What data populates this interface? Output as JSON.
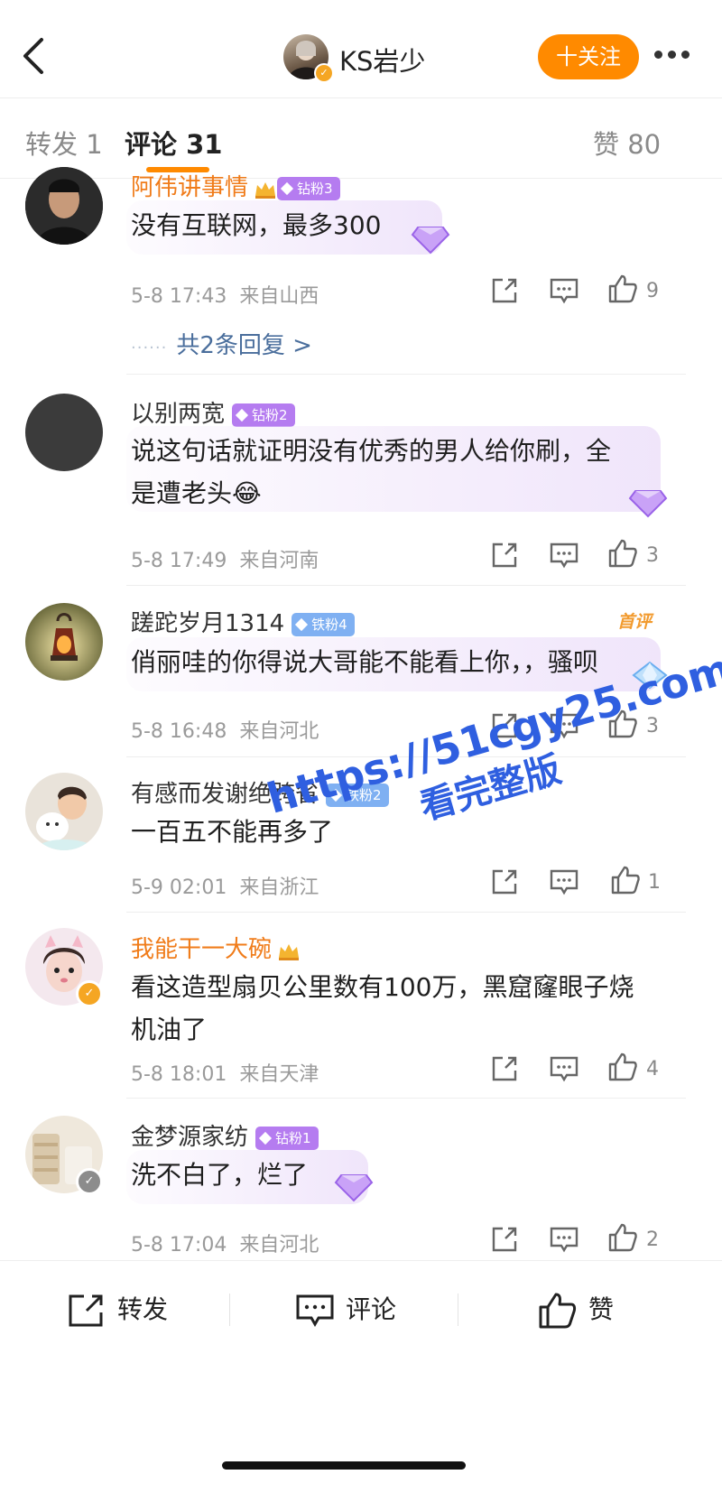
{
  "header": {
    "author_name": "KS岩少",
    "follow_label": "十关注"
  },
  "tabs": {
    "reposts": "转发 1",
    "comments": "评论 31",
    "likes": "赞 80"
  },
  "comments": [
    {
      "username": "阿伟讲事情",
      "name_color": "#f07c1a",
      "badge": "钻粉3",
      "text_lines": [
        "没有互联网，最多300"
      ],
      "date": "5-8 17:43",
      "location": "来自山西",
      "likes": "9",
      "replies": "共2条回复 >"
    },
    {
      "username": "以别两宽",
      "badge": "钻粉2",
      "text_lines": [
        "说这句话就证明没有优秀的男人给你刷，全",
        "是遭老头😂"
      ],
      "date": "5-8 17:49",
      "location": "来自河南",
      "likes": "3"
    },
    {
      "username": "蹉跎岁月1314",
      "badge": "铁粉4",
      "tag": "首评",
      "text_lines": [
        "俏丽哇的你得说大哥能不能看上你，，骚呗"
      ],
      "date": "5-8 16:48",
      "location": "来自河北",
      "likes": "3"
    },
    {
      "username": "有感而发谢绝跨省",
      "badge": "铁粉2",
      "text_lines": [
        "一百五不能再多了"
      ],
      "date": "5-9 02:01",
      "location": "来自浙江",
      "likes": "1"
    },
    {
      "username": "我能干一大碗",
      "name_color": "#f07c1a",
      "text_lines": [
        "看这造型扇贝公里数有100万，黑窟窿眼子烧",
        "机油了"
      ],
      "date": "5-8 18:01",
      "location": "来自天津",
      "likes": "4"
    },
    {
      "username": "金梦源家纺",
      "badge": "钻粉1",
      "text_lines": [
        "洗不白了，烂了"
      ],
      "date": "5-8 17:04",
      "location": "来自河北",
      "likes": "2"
    }
  ],
  "watermark": {
    "url": "https://51cgy25.com",
    "text": "看完整版"
  },
  "bottom_bar": {
    "repost": "转发",
    "comment": "评论",
    "like": "赞"
  },
  "colors": {
    "accent": "#ff8a00",
    "link": "#4a6e9c",
    "diamond_badge": "#b57cf0",
    "iron_badge": "#7fb0f2",
    "watermark": "#2f5fe0"
  }
}
